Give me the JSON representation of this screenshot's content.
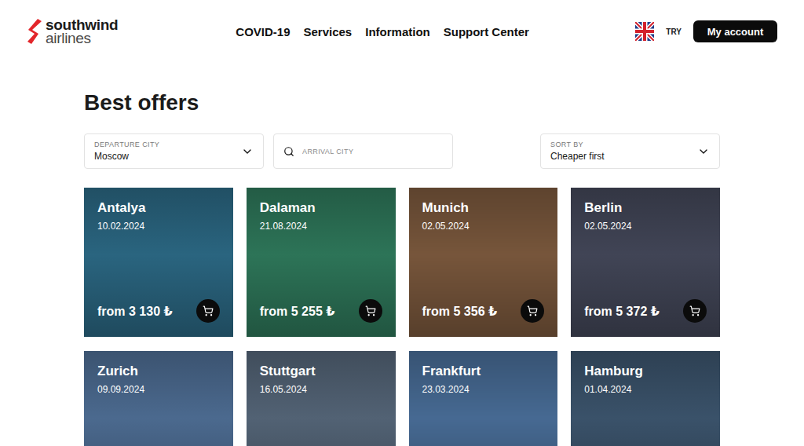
{
  "header": {
    "logo": {
      "top": "southwind",
      "bottom": "airlines"
    },
    "nav": [
      {
        "label": "COVID-19"
      },
      {
        "label": "Services"
      },
      {
        "label": "Information"
      },
      {
        "label": "Support Center"
      }
    ],
    "currency": "TRY",
    "account_button": "My account"
  },
  "page": {
    "title": "Best offers"
  },
  "filters": {
    "departure": {
      "label": "DEPARTURE CITY",
      "value": "Moscow"
    },
    "arrival": {
      "placeholder": "ARRIVAL CITY"
    },
    "sort": {
      "label": "SORT BY",
      "value": "Cheaper first"
    }
  },
  "offers": [
    {
      "city": "Antalya",
      "date": "10.02.2024",
      "price": "from 3 130 ₺",
      "color": "#2c6a86"
    },
    {
      "city": "Dalaman",
      "date": "21.08.2024",
      "price": "from 5 255 ₺",
      "color": "#2f7a5c"
    },
    {
      "city": "Munich",
      "date": "02.05.2024",
      "price": "from 5 356 ₺",
      "color": "#7d5a3e"
    },
    {
      "city": "Berlin",
      "date": "02.05.2024",
      "price": "from 5 372 ₺",
      "color": "#44485a"
    },
    {
      "city": "Zurich",
      "date": "09.09.2024",
      "color": "#4f6f96"
    },
    {
      "city": "Stuttgart",
      "date": "16.05.2024",
      "color": "#56677a"
    },
    {
      "city": "Frankfurt",
      "date": "23.03.2024",
      "color": "#4a6f9a"
    },
    {
      "city": "Hamburg",
      "date": "01.04.2024",
      "color": "#3d566f"
    }
  ]
}
